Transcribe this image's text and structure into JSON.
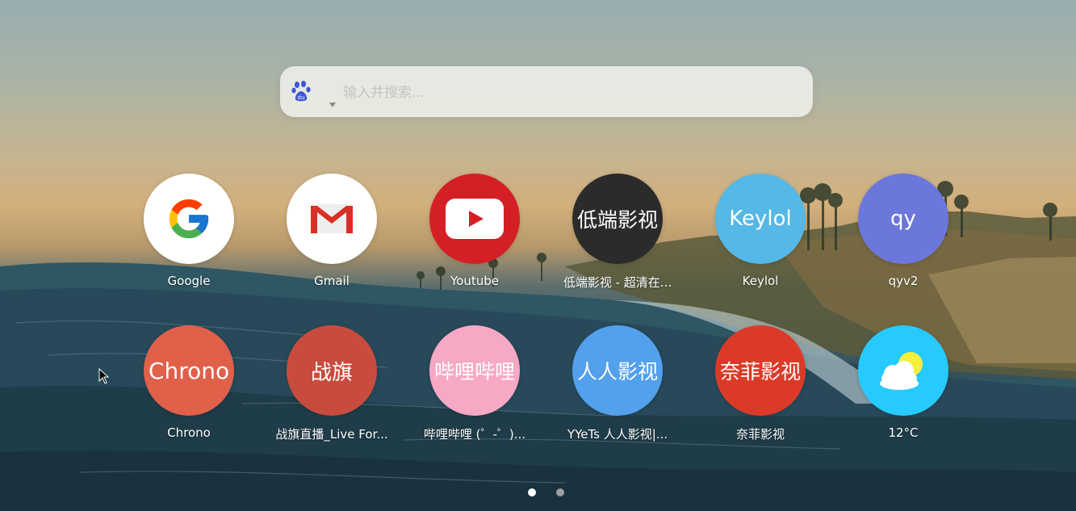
{
  "search": {
    "placeholder": "输入并搜索...",
    "value": "",
    "engine_icon": "baidu-paw-icon"
  },
  "tiles_row1": [
    {
      "label": "Google",
      "circle_text": "",
      "icon": "google-g-icon",
      "bg": "#ffffff"
    },
    {
      "label": "Gmail",
      "circle_text": "",
      "icon": "gmail-envelope-icon",
      "bg": "#ffffff"
    },
    {
      "label": "Youtube",
      "circle_text": "",
      "icon": "youtube-play-icon",
      "bg": "#d51f26"
    },
    {
      "label": "低端影视 - 超清在...",
      "circle_text": "低端影视",
      "icon": "",
      "bg": "#2b2b2b"
    },
    {
      "label": "Keylol",
      "circle_text": "Keylol",
      "icon": "",
      "bg": "#55b8e6"
    },
    {
      "label": "qyv2",
      "circle_text": "qy",
      "icon": "",
      "bg": "#6c77dc"
    }
  ],
  "tiles_row2": [
    {
      "label": "Chrono",
      "circle_text": "Chrono",
      "icon": "",
      "bg": "#e0604a"
    },
    {
      "label": "战旗直播_Live For...",
      "circle_text": "战旗",
      "icon": "",
      "bg": "#c84c3e"
    },
    {
      "label": "哔哩哔哩 (゜-゜)...",
      "circle_text": "哔哩哔哩",
      "icon": "",
      "bg": "#f7a8c4"
    },
    {
      "label": "YYeTs 人人影视|...",
      "circle_text": "人人影视",
      "icon": "",
      "bg": "#53a0ec"
    },
    {
      "label": "奈菲影视",
      "circle_text": "奈菲影视",
      "icon": "",
      "bg": "#dc3a28"
    },
    {
      "label": "12°C",
      "circle_text": "",
      "icon": "weather-partly-sunny-icon",
      "bg": "#27caff"
    }
  ],
  "pager": {
    "current_page": 1,
    "total_pages": 2
  },
  "colors": {
    "pager_active": "#ffffff",
    "pager_inactive": "#9aa0a3"
  }
}
